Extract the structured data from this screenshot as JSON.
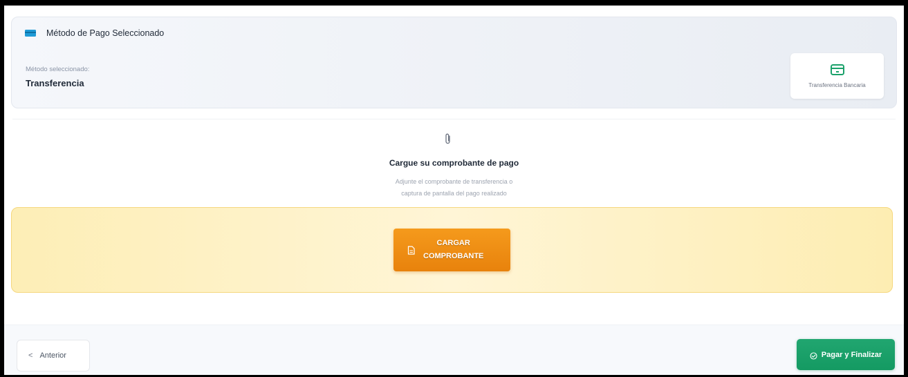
{
  "payment_method": {
    "header_title": "Método de Pago Seleccionado",
    "selected_label": "Método seleccionado:",
    "selected_value": "Transferencia",
    "option_label": "Transferencia Bancaria",
    "header_icon": "credit-card-icon",
    "option_icon": "bank-card-icon"
  },
  "upload": {
    "title": "Cargue su comprobante de pago",
    "description_line1": "Adjunte el comprobante de transferencia o",
    "description_line2": "captura de pantalla del pago realizado",
    "icon": "paperclip-icon",
    "button_line1": "CARGAR",
    "button_line2": "COMPROBANTE",
    "button_icon": "file-icon"
  },
  "footer": {
    "prev_chevron": "<",
    "prev_label": "Anterior",
    "finish_label": "Pagar y Finalizar",
    "finish_icon": "check-circle-icon"
  },
  "colors": {
    "accent_orange": "#f0900f",
    "accent_green": "#1aa16a",
    "card_blue": "#1e9ad6",
    "dropzone_bg": "#fdeeb6"
  }
}
